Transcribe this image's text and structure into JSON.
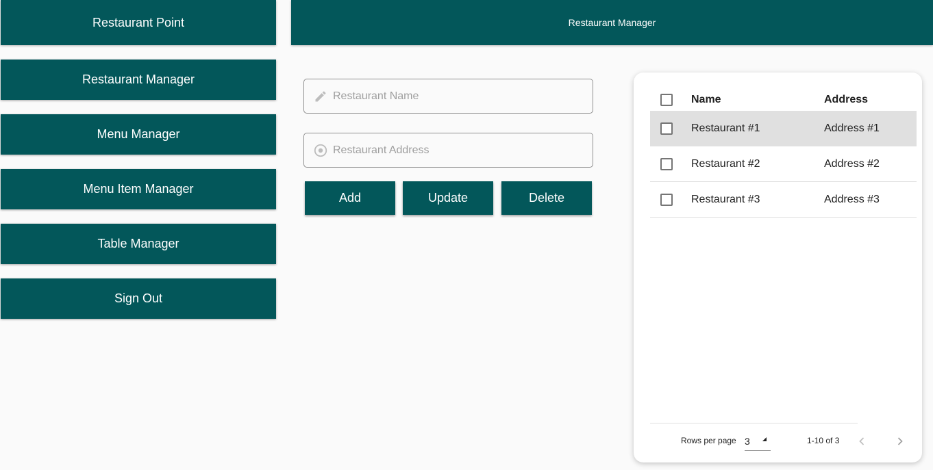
{
  "sidebar": {
    "title": "Restaurant Point",
    "items": [
      {
        "label": "Restaurant Manager"
      },
      {
        "label": "Menu Manager"
      },
      {
        "label": "Menu Item Manager"
      },
      {
        "label": "Table Manager"
      },
      {
        "label": "Sign Out"
      }
    ]
  },
  "header": {
    "title": "Restaurant Manager"
  },
  "form": {
    "name_placeholder": "Restaurant Name",
    "name_value": "",
    "name_icon": "pencil-icon",
    "address_placeholder": "Restaurant Address",
    "address_value": "",
    "address_icon": "location-icon",
    "buttons": {
      "add": "Add",
      "update": "Update",
      "delete": "Delete"
    }
  },
  "table": {
    "columns": {
      "name": "Name",
      "address": "Address"
    },
    "rows": [
      {
        "name": "Restaurant #1",
        "address": "Address #1",
        "selected": true
      },
      {
        "name": "Restaurant #2",
        "address": "Address #2",
        "selected": false
      },
      {
        "name": "Restaurant #3",
        "address": "Address #3",
        "selected": false
      }
    ],
    "footer": {
      "rows_per_page_label": "Rows per page",
      "rows_per_page_value": "3",
      "range": "1-10 of 3"
    }
  },
  "colors": {
    "primary": "#03575a",
    "background": "#fafafa",
    "selected_row": "#e0e0e0"
  }
}
